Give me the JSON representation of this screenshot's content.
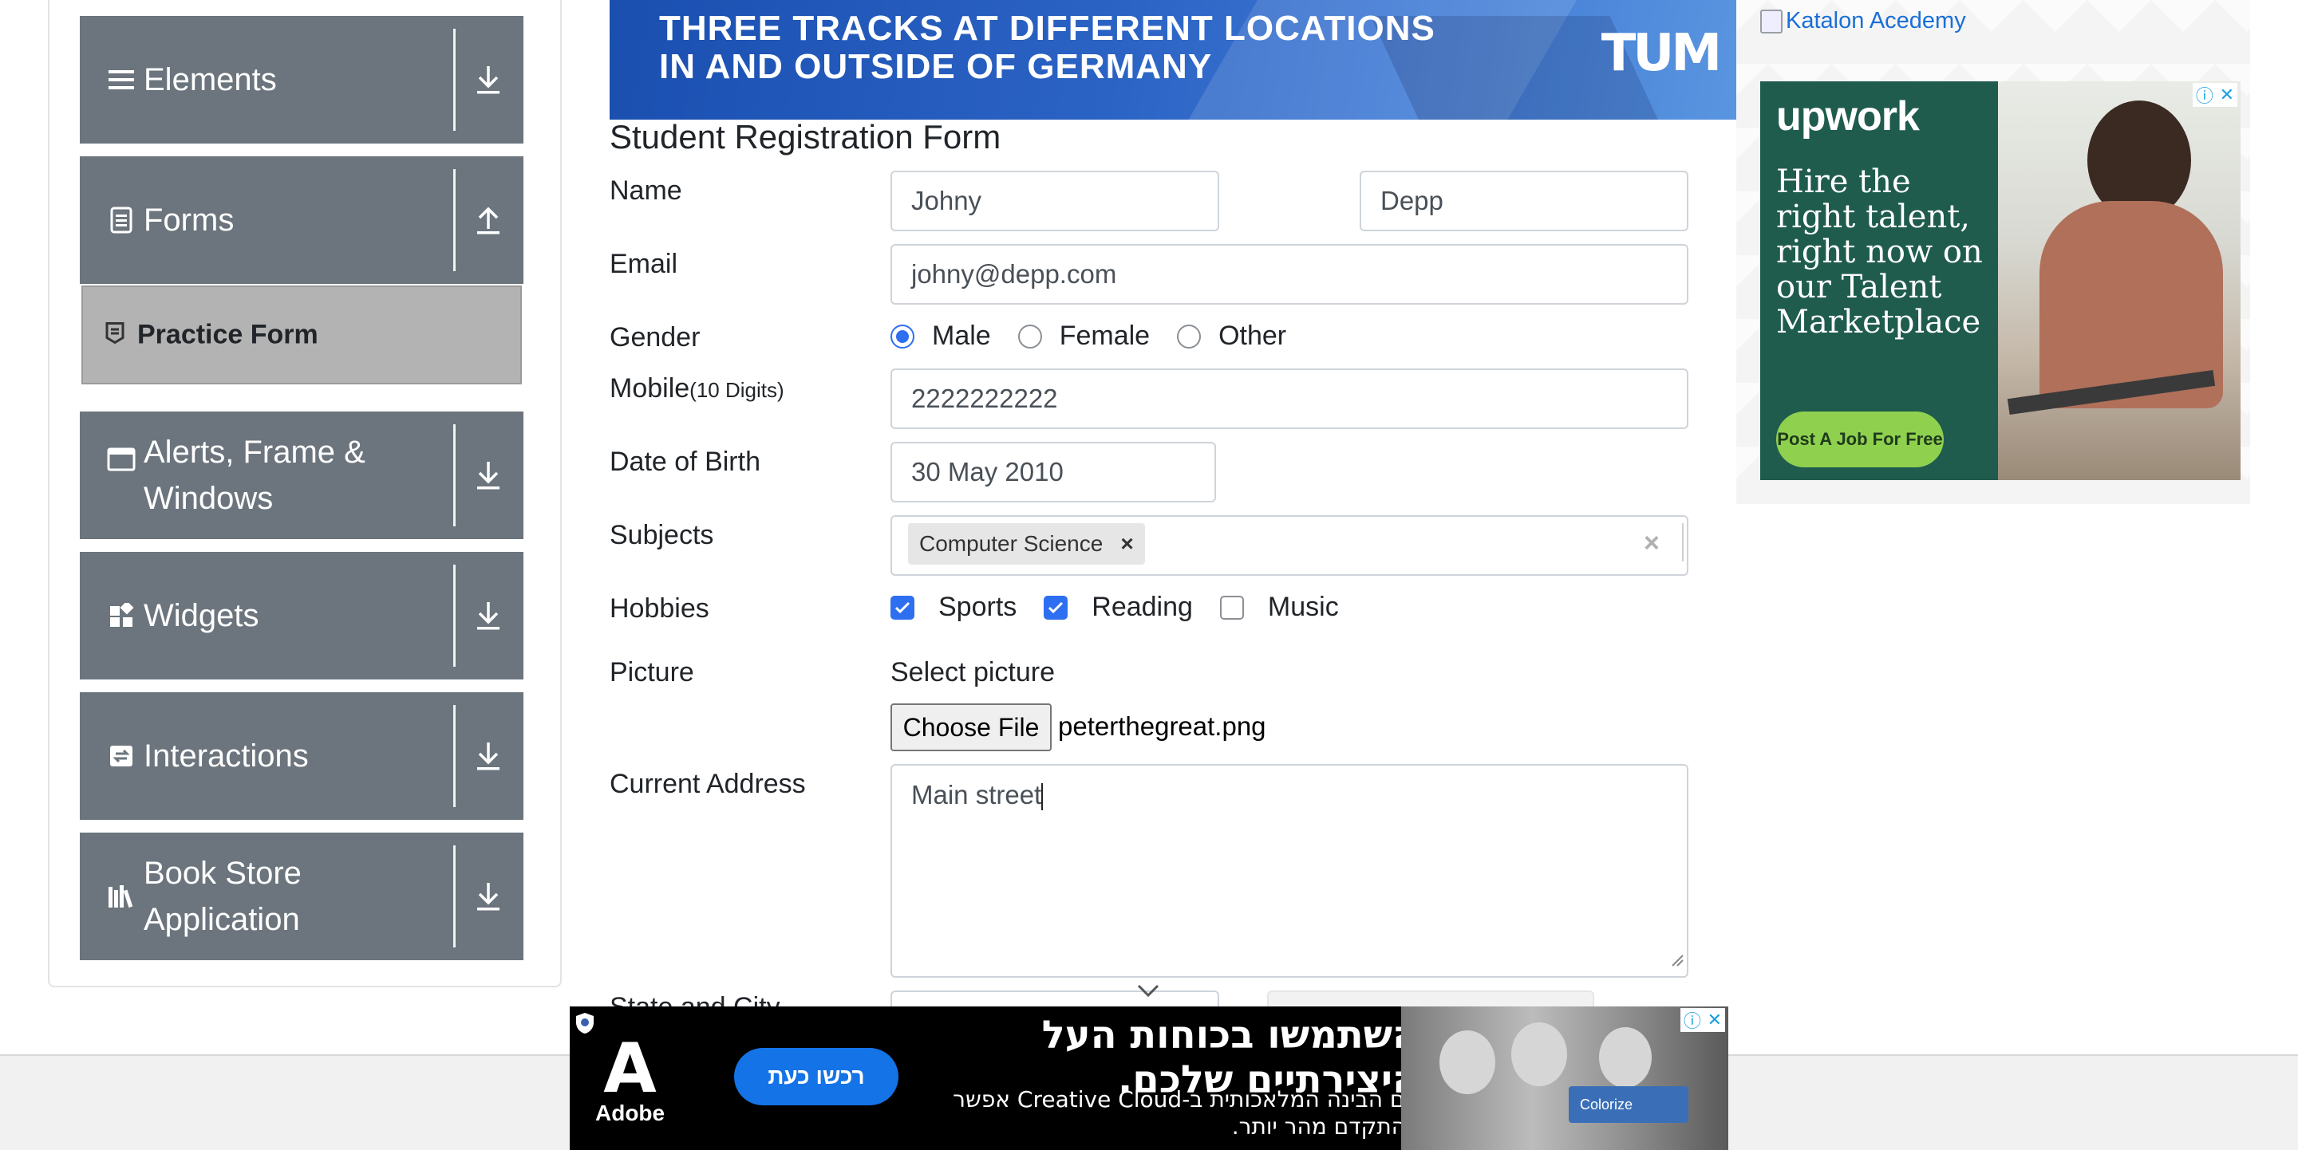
{
  "sidebar": {
    "groups": [
      {
        "label": "Elements",
        "icon": "list-icon",
        "arrow": "download-arrow-icon"
      },
      {
        "label": "Forms",
        "icon": "document-icon",
        "arrow": "upload-arrow-icon"
      },
      {
        "label": "Alerts, Frame & Windows",
        "icon": "window-icon",
        "arrow": "download-arrow-icon"
      },
      {
        "label": "Widgets",
        "icon": "widgets-icon",
        "arrow": "download-arrow-icon"
      },
      {
        "label": "Interactions",
        "icon": "interactions-icon",
        "arrow": "download-arrow-icon"
      },
      {
        "label": "Book Store Application",
        "icon": "books-icon",
        "arrow": "download-arrow-icon"
      }
    ],
    "active_item": {
      "label": "Practice Form",
      "icon": "form-icon"
    }
  },
  "banner": {
    "line1": "THREE TRACKS AT DIFFERENT LOCATIONS",
    "line2": "IN AND OUTSIDE OF GERMANY",
    "logo": "TUM"
  },
  "form": {
    "title": "Student Registration Form",
    "name_label": "Name",
    "first_name": "Johny",
    "last_name": "Depp",
    "email_label": "Email",
    "email": "johny@depp.com",
    "gender_label": "Gender",
    "gender_options": [
      "Male",
      "Female",
      "Other"
    ],
    "gender_selected": "Male",
    "mobile_label": "Mobile",
    "mobile_hint": "(10 Digits)",
    "mobile": "2222222222",
    "dob_label": "Date of Birth",
    "dob": "30 May 2010",
    "subjects_label": "Subjects",
    "subject_chip": "Computer Science",
    "hobbies_label": "Hobbies",
    "hobbies": [
      {
        "label": "Sports",
        "checked": true
      },
      {
        "label": "Reading",
        "checked": true
      },
      {
        "label": "Music",
        "checked": false
      }
    ],
    "picture_label": "Picture",
    "select_picture": "Select picture",
    "choose_file": "Choose File",
    "file_name": "peterthegreat.png",
    "address_label": "Current Address",
    "address": "Main street",
    "state_city_label": "State and City"
  },
  "right_ad": {
    "katalon_alt": "Katalon Acedemy",
    "upwork_logo": "upwork",
    "headline": "Hire the right talent, right now on our Talent Marketplace",
    "cta": "Post A Job For Free"
  },
  "bottom_ad": {
    "brand": "Adobe",
    "cta": "רכשו כעת",
    "headline": "השתמשו בכוחות העל היצירתיים שלכם.",
    "sub": "עם הבינה המלאכותית ב-Creative Cloud אפשר להתקדם מהר יותר.",
    "photo_button": "Colorize"
  },
  "colors": {
    "sidebar_group": "#6c757d",
    "active_item": "#b3b3b3",
    "accent_blue": "#2d6ff0",
    "upwork_green": "#1f5c4e",
    "upwork_cta": "#8fd14f",
    "adobe_blue": "#1473e6"
  }
}
